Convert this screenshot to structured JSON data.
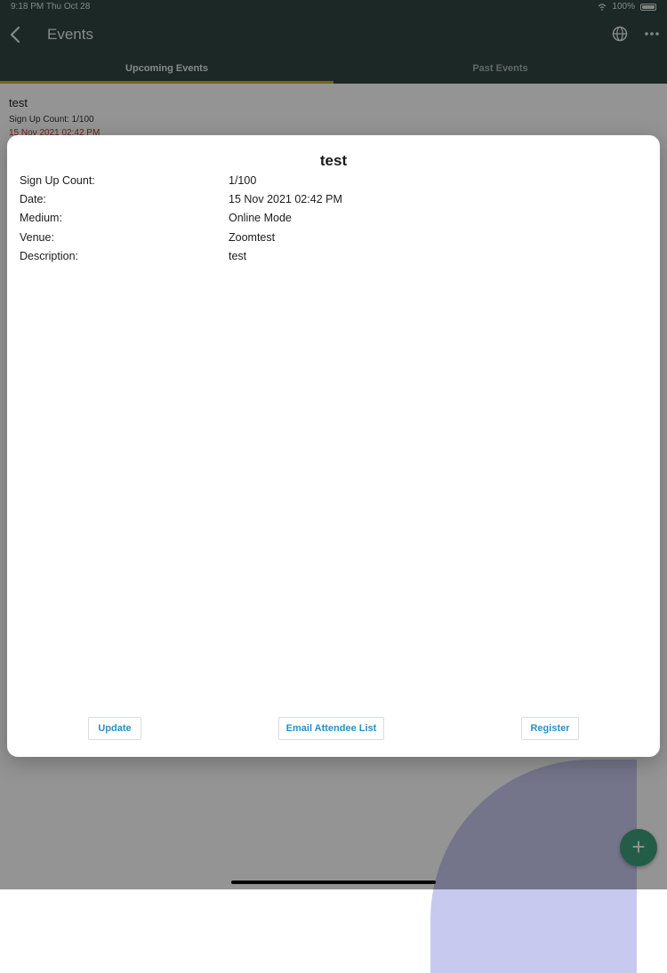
{
  "status_bar": {
    "time": "9:18 PM  Thu Oct 28",
    "battery": "100%"
  },
  "header": {
    "title": "Events",
    "icons": {
      "back": "chevron-left-icon",
      "globe": "globe-icon",
      "more": "more-horizontal-icon"
    }
  },
  "tabs": [
    {
      "label": "Upcoming Events",
      "active": true
    },
    {
      "label": "Past Events",
      "active": false
    }
  ],
  "events": [
    {
      "title": "test",
      "signup": "Sign Up Count: 1/100",
      "date": "15 Nov 2021 02:42 PM"
    }
  ],
  "modal": {
    "title": "test",
    "fields": [
      {
        "label": "Sign Up Count:",
        "value": "1/100"
      },
      {
        "label": "Date:",
        "value": "15 Nov 2021 02:42 PM"
      },
      {
        "label": "Medium:",
        "value": "Online Mode"
      },
      {
        "label": "Venue:",
        "value": "Zoomtest"
      },
      {
        "label": "Description:",
        "value": "test"
      }
    ],
    "buttons": {
      "update": "Update",
      "email": "Email Attendee List",
      "register": "Register"
    }
  },
  "fab": {
    "label": "+"
  },
  "colors": {
    "header_bg": "#2f4640",
    "tab_accent": "#c9b226",
    "date_red": "#c0392b",
    "button_text": "#2a8fc6",
    "fab_bg": "#3fa07a"
  }
}
